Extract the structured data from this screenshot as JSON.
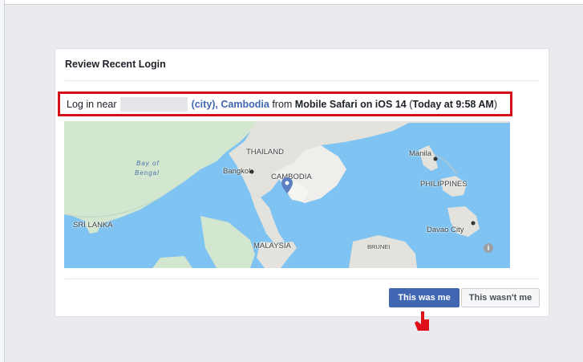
{
  "card": {
    "title": "Review Recent Login"
  },
  "login": {
    "prefix": "Log in near",
    "city": "(city),",
    "country": "Cambodia",
    "from_text": "from",
    "device": "Mobile Safari on iOS 14",
    "time_open": "(",
    "time": "Today at 9:58 AM",
    "time_close": ")"
  },
  "map": {
    "labels": {
      "bay_of_bengal_1": "Bay of",
      "bay_of_bengal_2": "Bengal",
      "thailand": "THAILAND",
      "bangkok": "Bangkok",
      "cambodia": "CAMBODIA",
      "manila": "Manila",
      "philippines": "PHILIPPINES",
      "sri_lanka": "SRI LANKA",
      "davao": "Davao City",
      "malaysia": "MALAYSIA",
      "brunei": "BRUNEI"
    },
    "info_symbol": "i",
    "marker_icon": "map-pin-icon"
  },
  "actions": {
    "confirm": "This was me",
    "deny": "This wasn't me"
  },
  "colors": {
    "highlight_box": "#d40f1a",
    "primary": "#4267b2",
    "cursor": "#e0101a"
  }
}
